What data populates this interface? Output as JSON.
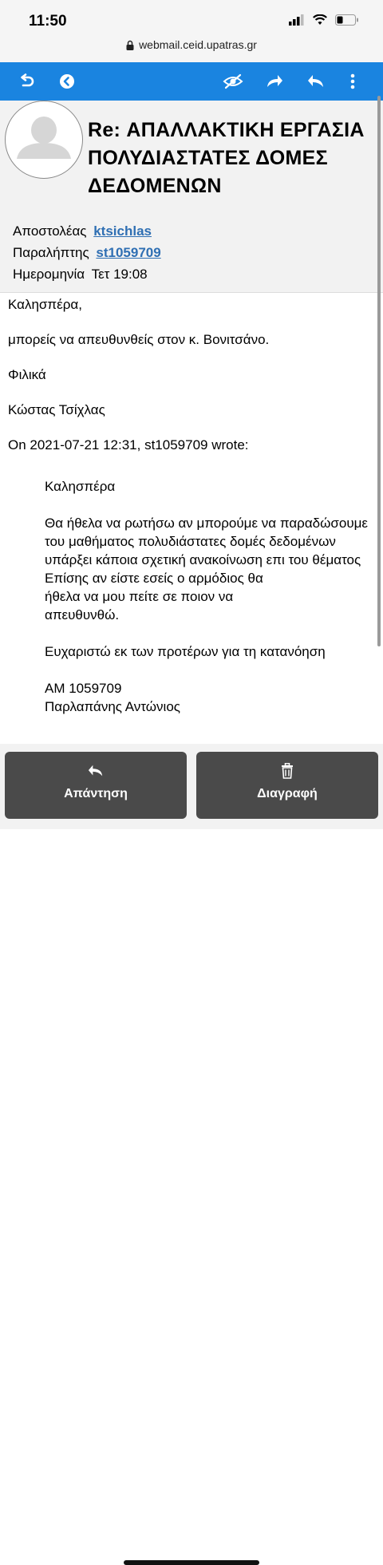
{
  "status_bar": {
    "time": "11:50"
  },
  "url_bar": {
    "url": "webmail.ceid.upatras.gr"
  },
  "toolbar": {
    "icons": [
      "back-icon",
      "circle-back-icon",
      "hide-images-icon",
      "forward-icon",
      "reply-icon",
      "more-icon"
    ],
    "accent_color": "#1a84e0"
  },
  "message": {
    "subject": "Re: ΑΠΑΛΛΑΚΤΙΚΗ ΕΡΓΑΣΙΑ ΠΟΛΥΔΙΑΣΤΑΤΕΣ ΔΟΜΕΣ ΔΕΔΟΜΕΝΩΝ",
    "sender_label": "Αποστολέας",
    "sender": "ktsichlas",
    "recipient_label": "Παραλήπτης",
    "recipient": "st1059709",
    "date_label": "Ημερομηνία",
    "date": "Τετ 19:08",
    "body": {
      "greeting": "Καλησπέρα,",
      "line1": "μπορείς να απευθυνθείς στον κ. Βονιτσάνο.",
      "closing": "Φιλικά",
      "signature": "Κώστας Τσίχλας",
      "quote_header": "On 2021-07-21 12:31, st1059709 wrote:"
    },
    "quoted": {
      "greeting": "Καλησπέρα",
      "paragraph": "Θα ήθελα να ρωτήσω αν μπορούμε να παραδώσουμε\nτου μαθήματος πολυδιάστατες δομές δεδομένων\nυπάρξει κάποια σχετική ανακοίνωση επι του θέματος\nΕπίσης αν είστε εσείς ο αρμόδιος θα\nήθελα να μου πείτε σε ποιον να\nαπευθυνθώ.",
      "thanks": "Ευχαριστώ εκ των προτέρων για τη κατανόηση",
      "signature": "AM 1059709\nΠαρλαπάνης Αντώνιος"
    }
  },
  "actions": {
    "reply_label": "Απάντηση",
    "delete_label": "Διαγραφή"
  }
}
